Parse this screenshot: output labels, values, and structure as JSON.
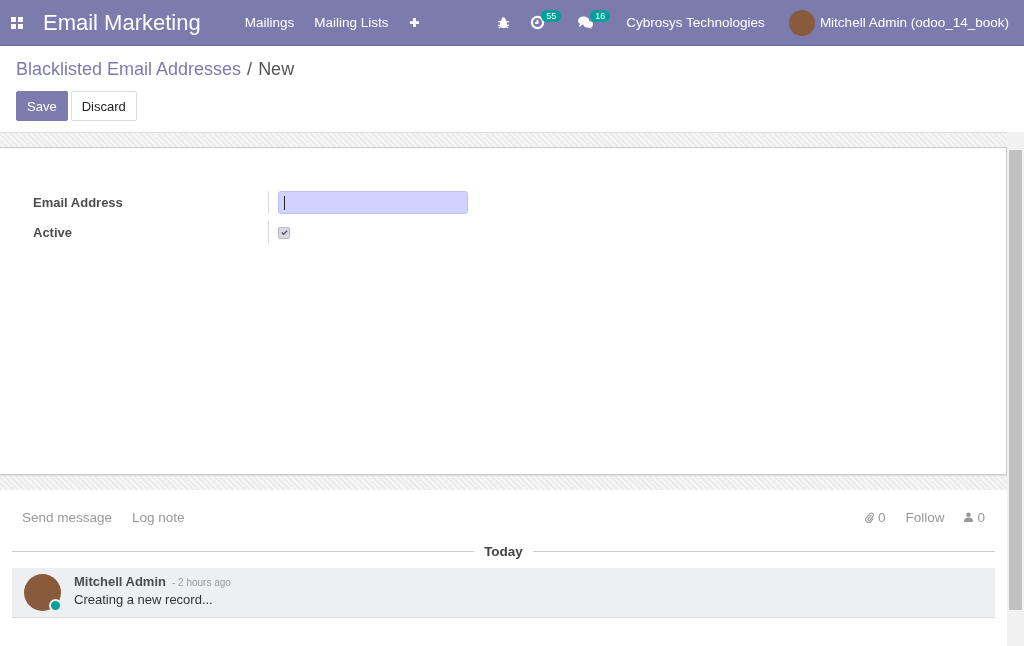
{
  "navbar": {
    "app_name": "Email Marketing",
    "menu": [
      "Mailings",
      "Mailing Lists"
    ],
    "activity_count": "55",
    "message_count": "16",
    "company": "Cybrosys Technologies",
    "user": "Mitchell Admin (odoo_14_book)"
  },
  "breadcrumb": {
    "parent": "Blacklisted Email Addresses",
    "separator": "/",
    "current": "New"
  },
  "buttons": {
    "save": "Save",
    "discard": "Discard"
  },
  "form": {
    "fields": [
      {
        "kind": "text",
        "label": "Email Address",
        "focused": true
      },
      {
        "kind": "checkbox",
        "label": "Active",
        "checked": true
      }
    ]
  },
  "chatter": {
    "send_message": "Send message",
    "log_note": "Log note",
    "attachments": "0",
    "follow": "Follow",
    "followers": "0",
    "divider": "Today",
    "messages": [
      {
        "author": "Mitchell Admin",
        "time": "- 2 hours ago",
        "body": "Creating a new record...",
        "online": true
      }
    ]
  }
}
